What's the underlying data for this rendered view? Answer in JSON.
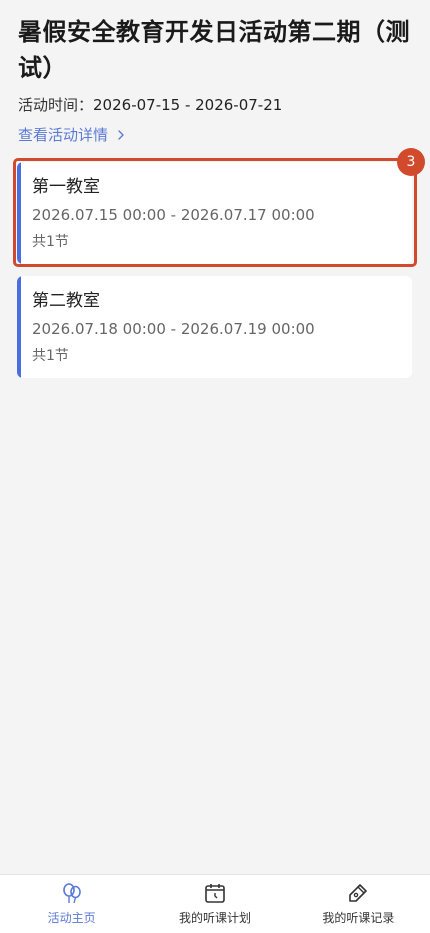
{
  "activity": {
    "title": "暑假安全教育开发日活动第二期（测试）",
    "time_label": "活动时间：",
    "time_range": "2026-07-15 - 2026-07-21",
    "detail_link": "查看活动详情"
  },
  "classrooms": [
    {
      "name": "第一教室",
      "range": "2026.07.15 00:00 - 2026.07.17 00:00",
      "count": "共1节"
    },
    {
      "name": "第二教室",
      "range": "2026.07.18 00:00 - 2026.07.19 00:00",
      "count": "共1节"
    }
  ],
  "highlight_badge": "3",
  "tabbar": {
    "items": [
      {
        "label": "活动主页",
        "icon": "balloon-icon",
        "active": true
      },
      {
        "label": "我的听课计划",
        "icon": "calendar-icon",
        "active": false
      },
      {
        "label": "我的听课记录",
        "icon": "pencil-icon",
        "active": false
      }
    ]
  },
  "colors": {
    "accent": "#4a6ee0",
    "link": "#5b7ad6",
    "highlight": "#d24a2c",
    "background": "#f4f4f4"
  }
}
